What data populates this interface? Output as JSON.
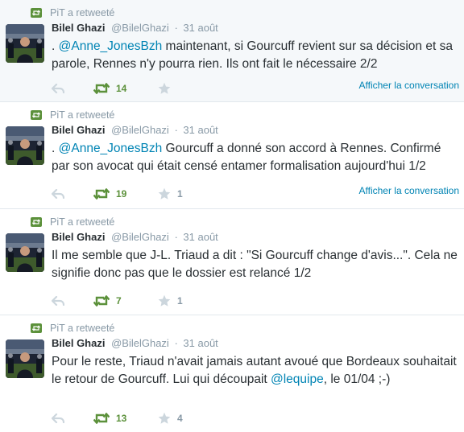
{
  "colors": {
    "link": "#0084b4",
    "retweet_green": "#5c913b",
    "muted": "#8899a6",
    "text": "#292f33",
    "highlight_bg": "#f5f8fa"
  },
  "icons": {
    "retweet_badge": "retweet-icon",
    "reply": "reply-icon",
    "retweet": "retweet-icon",
    "favorite": "star-icon"
  },
  "tweets": [
    {
      "retweet_label": "PiT a retweeté",
      "name": "Bilel Ghazi",
      "handle": "@BilelGhazi",
      "separator": "·",
      "time": "31 août",
      "text_before": ". ",
      "mention": "@Anne_JonesBzh",
      "text_after": " maintenant, si Gourcuff revient sur sa décision et sa parole, Rennes n'y pourra rien. Ils ont fait le nécessaire 2/2",
      "retweets": "14",
      "favorites": "",
      "show_conversation": "Afficher la conversation"
    },
    {
      "retweet_label": "PiT a retweeté",
      "name": "Bilel Ghazi",
      "handle": "@BilelGhazi",
      "separator": "·",
      "time": "31 août",
      "text_before": ". ",
      "mention": "@Anne_JonesBzh",
      "text_after": " Gourcuff a donné son accord à Rennes. Confirmé par son avocat qui était censé entamer formalisation aujourd'hui 1/2",
      "retweets": "19",
      "favorites": "1",
      "show_conversation": "Afficher la conversation"
    },
    {
      "retweet_label": "PiT a retweeté",
      "name": "Bilel Ghazi",
      "handle": "@BilelGhazi",
      "separator": "·",
      "time": "31 août",
      "text_before": "Il me semble que J-L. Triaud a dit : \"Si Gourcuff change d'avis...\". Cela ne signifie donc pas que le dossier est relancé 1/2",
      "mention": "",
      "text_after": "",
      "retweets": "7",
      "favorites": "1",
      "show_conversation": ""
    },
    {
      "retweet_label": "PiT a retweeté",
      "name": "Bilel Ghazi",
      "handle": "@BilelGhazi",
      "separator": "·",
      "time": "31 août",
      "text_before": "Pour le reste, Triaud n'avait jamais autant avoué que Bordeaux souhaitait le retour de Gourcuff. Lui qui découpait ",
      "mention": "@lequipe",
      "text_after": ", le 01/04 ;-)",
      "retweets": "13",
      "favorites": "4",
      "show_conversation": ""
    }
  ]
}
